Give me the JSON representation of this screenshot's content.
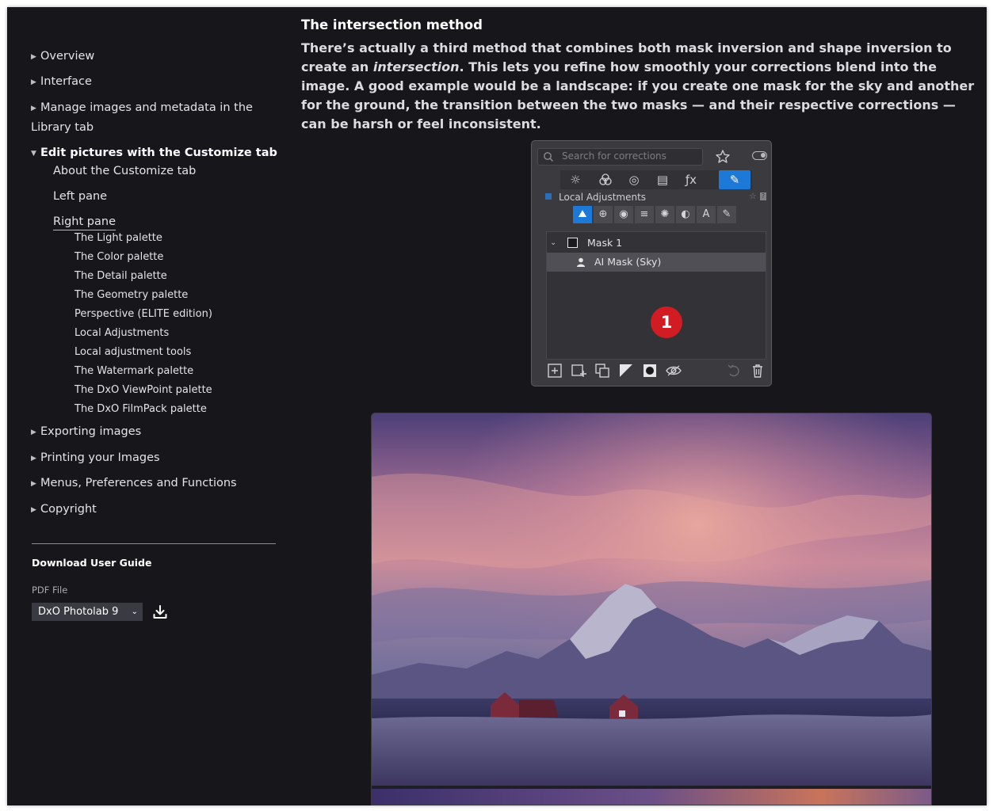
{
  "sidebar": {
    "items": [
      {
        "label": "Overview"
      },
      {
        "label": "Interface"
      },
      {
        "label_line1": "Manage images and metadata in the",
        "label_line2": "Library tab"
      },
      {
        "label": "Edit pictures with the Customize tab"
      },
      {
        "label": "Exporting images"
      },
      {
        "label": "Printing your Images"
      },
      {
        "label": "Menus, Preferences and Functions"
      },
      {
        "label": "Copyright"
      }
    ],
    "sub_items": [
      "About the Customize tab",
      "Left pane",
      "Right pane"
    ],
    "right_pane_items": [
      "The Light palette",
      "The Color palette",
      "The Detail palette",
      "The Geometry palette",
      "Perspective (ELITE edition)",
      "Local Adjustments",
      "Local adjustment tools",
      "The Watermark palette",
      "The DxO ViewPoint palette",
      "The DxO FilmPack palette"
    ],
    "download": {
      "title": "Download User Guide",
      "pdf_label": "PDF File",
      "selected_version": "DxO Photolab 9",
      "download_icon": "download-icon"
    }
  },
  "main": {
    "heading": "The intersection method",
    "paragraph_part1": "There’s actually a third method that combines both mask inversion and shape inversion to create an ",
    "paragraph_em": "intersection",
    "paragraph_part2": ". This lets you refine how smoothly your corrections blend into the image. A good example would be a landscape: if you create one mask for the sky and another for the ground, the transition between the two masks — and their respective corrections — can be harsh or feel inconsistent."
  },
  "palette": {
    "search_placeholder": "Search for corrections",
    "tab_icons": [
      "sun-icon",
      "color-circles-icon",
      "lens-icon",
      "geometry-icon",
      "fx-icon",
      "local-adjust-icon"
    ],
    "tab_fx": "ƒx",
    "section_title": "Local Adjustments",
    "masks": [
      {
        "label": "Mask 1"
      },
      {
        "label": "AI Mask (Sky)"
      }
    ],
    "badge": "1"
  },
  "colors": {
    "accent": "#1c79d8",
    "badge": "#d01c22",
    "background": "#17171b"
  }
}
